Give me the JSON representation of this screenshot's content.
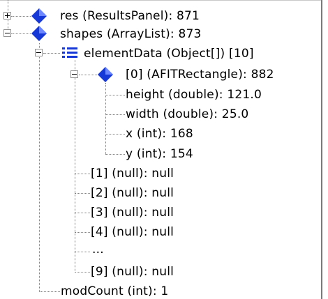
{
  "tree": {
    "res_label": "res (ResultsPanel): 871",
    "shapes_label": "shapes (ArrayList): 873",
    "element_data_label": "elementData (Object[]) [10]",
    "item0_label": "[0] (AFITRectangle): 882",
    "height_label": "height (double): 121.0",
    "width_label": "width (double): 25.0",
    "x_label": "x (int): 168",
    "y_label": "y (int): 154",
    "item1_label": "[1] (null): null",
    "item2_label": "[2] (null): null",
    "item3_label": "[3] (null): null",
    "item4_label": "[4] (null): null",
    "ellipsis_label": "...",
    "item9_label": "[9] (null): null",
    "modcount_label": "modCount (int): 1"
  },
  "colors": {
    "diamond": "#1538d6",
    "list_icon": "#1538d6"
  }
}
